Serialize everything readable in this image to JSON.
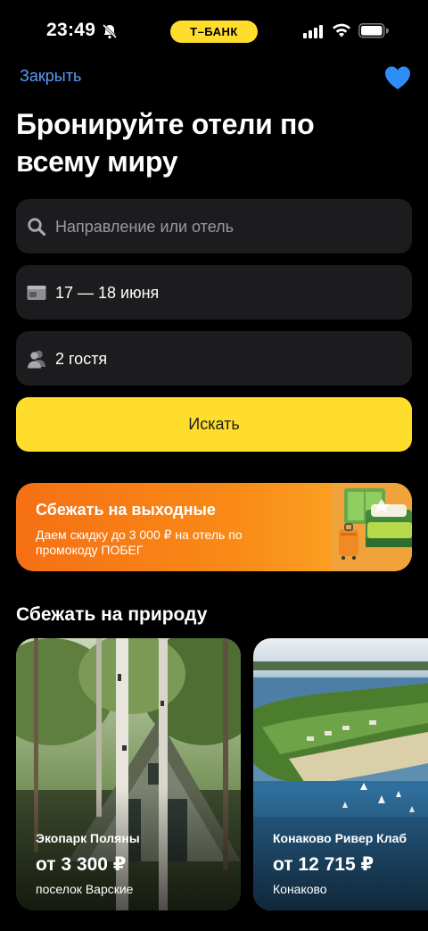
{
  "status_bar": {
    "time": "23:49",
    "carrier": "T–БАНК"
  },
  "header": {
    "close_label": "Закрыть",
    "title": "Бронируйте отели по всему миру",
    "accent_color": "#5b9cf5"
  },
  "form": {
    "destination_placeholder": "Направление или отель",
    "dates_value": "17 — 18 июня",
    "guests_value": "2 гостя",
    "search_label": "Искать",
    "button_color": "#ffdd2d"
  },
  "promo": {
    "title": "Сбежать на выходные",
    "subtitle": "Даем скидку до 3 000 ₽ на отель по промокоду ПОБЕГ"
  },
  "section": {
    "title": "Сбежать на природу"
  },
  "cards": [
    {
      "name": "Экопарк Поляны",
      "price": "от 3 300 ₽",
      "location": "поселок Варские"
    },
    {
      "name": "Конаково Ривер Клаб",
      "price": "от 12 715 ₽",
      "location": "Конаково"
    }
  ],
  "icons": {
    "bell": "bell-off-icon",
    "heart": "heart-icon",
    "search": "search-icon",
    "calendar": "calendar-icon",
    "guests": "guests-icon"
  }
}
